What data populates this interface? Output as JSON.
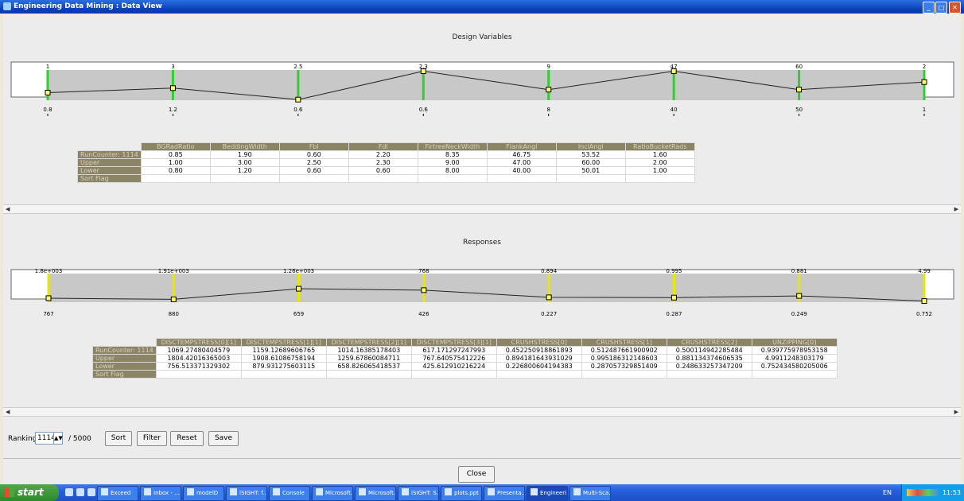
{
  "window": {
    "title": "Engineering Data Mining : Data View"
  },
  "design": {
    "title": "Design Variables",
    "axes": [
      {
        "name": "BGRadRatio",
        "upper": "1",
        "lower": "0.8",
        "value": 0.25
      },
      {
        "name": "BeddingWidth",
        "upper": "3",
        "lower": "1.2",
        "value": 0.4
      },
      {
        "name": "Fbl",
        "upper": "2.5",
        "lower": "0.6",
        "value": 0.02
      },
      {
        "name": "Fdl",
        "upper": "2.3",
        "lower": "0.6",
        "value": 0.96
      },
      {
        "name": "FirtreeNeckWidth",
        "upper": "9",
        "lower": "8",
        "value": 0.35
      },
      {
        "name": "FlankAngl",
        "upper": "47",
        "lower": "40",
        "value": 0.96
      },
      {
        "name": "InclAngl",
        "upper": "60",
        "lower": "50",
        "value": 0.35
      },
      {
        "name": "RatioBucketRads",
        "upper": "2",
        "lower": "1",
        "value": 0.6
      }
    ],
    "table": {
      "headers": [
        "BGRadRatio",
        "BeddingWidth",
        "Fbl",
        "Fdl",
        "FirtreeNeckWidth",
        "FlankAngl",
        "InclAngl",
        "RatioBucketRads"
      ],
      "rows": [
        {
          "label": "RunCounter: 1114",
          "cells": [
            "0.85",
            "1.90",
            "0.60",
            "2.20",
            "8.35",
            "46.75",
            "53.52",
            "1.60"
          ]
        },
        {
          "label": "Upper",
          "cells": [
            "1.00",
            "3.00",
            "2.50",
            "2.30",
            "9.00",
            "47.00",
            "60.00",
            "2.00"
          ]
        },
        {
          "label": "Lower",
          "cells": [
            "0.80",
            "1.20",
            "0.60",
            "0.60",
            "8.00",
            "40.00",
            "50.01",
            "1.00"
          ]
        },
        {
          "label": "Sort Flag",
          "cells": [
            "",
            "",
            "",
            "",
            "",
            "",
            "",
            ""
          ]
        }
      ]
    }
  },
  "responses": {
    "title": "Responses",
    "axes": [
      {
        "name": "DISCTEMPSTRESS[0][1]",
        "upper": "1.8e+003",
        "lower": "767",
        "value": 0.14
      },
      {
        "name": "DISCTEMPSTRESS[1][1]",
        "upper": "1.91e+003",
        "lower": "880",
        "value": 0.1
      },
      {
        "name": "DISCTEMPSTRESS[2][1]",
        "upper": "1.26e+003",
        "lower": "659",
        "value": 0.47
      },
      {
        "name": "DISCTEMPSTRESS[3][1]",
        "upper": "768",
        "lower": "426",
        "value": 0.42
      },
      {
        "name": "CRUSHSTRESS[0]",
        "upper": "0.894",
        "lower": "0.227",
        "value": 0.17
      },
      {
        "name": "CRUSHSTRESS[1]",
        "upper": "0.995",
        "lower": "0.287",
        "value": 0.16
      },
      {
        "name": "CRUSHSTRESS[2]",
        "upper": "0.881",
        "lower": "0.249",
        "value": 0.22
      },
      {
        "name": "UNZIPPING[0]",
        "upper": "4.99",
        "lower": "0.752",
        "value": 0.04
      }
    ],
    "table": {
      "headers": [
        "DISCTEMPSTRESS[0][1]",
        "DISCTEMPSTRESS[1][1]",
        "DISCTEMPSTRESS[2][1]",
        "DISCTEMPSTRESS[3][1]",
        "CRUSHSTRESS[0]",
        "CRUSHSTRESS[1]",
        "CRUSHSTRESS[2]",
        "UNZIPPING[0]"
      ],
      "rows": [
        {
          "label": "RunCounter: 1114",
          "cells": [
            "1069.27480404579",
            "1159.12689606765",
            "1014.16385178403",
            "617.171297247993",
            "0.452250918861893",
            "0.512487661900902",
            "0.500114942285484",
            "0.939775978953158"
          ]
        },
        {
          "label": "Upper",
          "cells": [
            "1804.42016365003",
            "1908.61086758194",
            "1259.67860084711",
            "767.640575412226",
            "0.894181643931029",
            "0.995186312148603",
            "0.881134374606535",
            "4.9911248303179"
          ]
        },
        {
          "label": "Lower",
          "cells": [
            "756.513371329302",
            "879.931275603115",
            "658.826065418537",
            "425.612910216224",
            "0.226800604194383",
            "0.287057329851409",
            "0.248633257347209",
            "0.752434580205006"
          ]
        },
        {
          "label": "Sort Flag",
          "cells": [
            "",
            "",
            "",
            "",
            "",
            "",
            "",
            ""
          ]
        }
      ]
    }
  },
  "ranking": {
    "label": "Ranking:",
    "value": "1114",
    "total": "/ 5000"
  },
  "buttons": {
    "sort": "Sort",
    "filter": "Filter",
    "reset": "Reset",
    "save": "Save",
    "close": "Close"
  },
  "taskbar": {
    "start": "start",
    "items": [
      "Exceed",
      "Inbox - ...",
      "modelD",
      "iSIGHT: f...",
      "Console",
      "Microsoft...",
      "Microsoft...",
      "iSIGHT: S...",
      "plots.ppt",
      "Presenta...",
      "Engineeri...",
      "Multi-Sca..."
    ],
    "active_index": 10,
    "lang": "EN",
    "clock": "11:53"
  },
  "colors": {
    "design_axis": "#33cc33",
    "response_axis": "#e8e800",
    "band": "#c8c8c8",
    "header_bg": "#8c8466"
  }
}
